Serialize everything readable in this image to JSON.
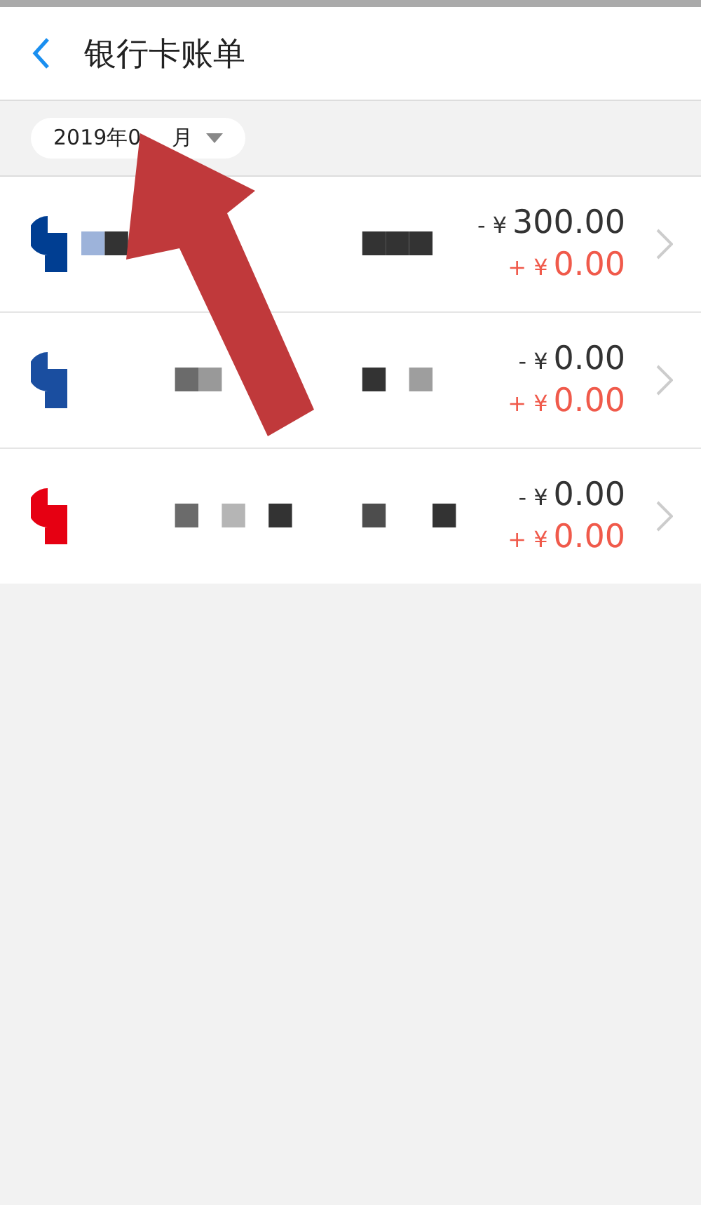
{
  "header": {
    "title": "银行卡账单"
  },
  "month_filter": {
    "parts": [
      "2019年0",
      "月"
    ]
  },
  "bills": [
    {
      "color": "#003e92",
      "out_prefix": "- ¥",
      "out_amount": "300.00",
      "in_prefix": "+ ¥",
      "in_amount": "0.00"
    },
    {
      "color": "#1a4ea0",
      "out_prefix": "- ¥",
      "out_amount": "0.00",
      "in_prefix": "+ ¥",
      "in_amount": "0.00"
    },
    {
      "color": "#e60012",
      "out_prefix": "- ¥",
      "out_amount": "0.00",
      "in_prefix": "+ ¥",
      "in_amount": "0.00"
    }
  ]
}
